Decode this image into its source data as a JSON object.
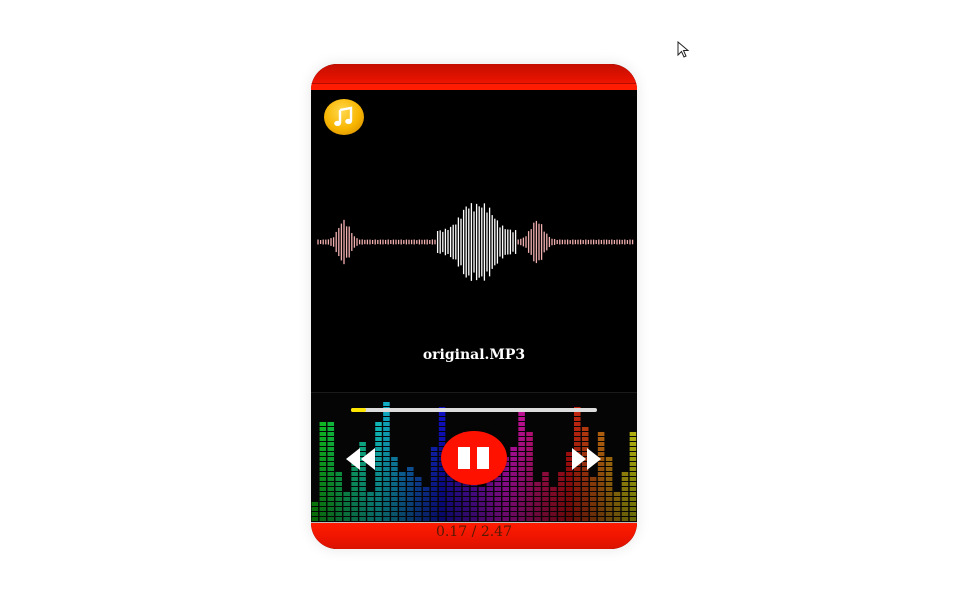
{
  "player": {
    "track_title": "original.MP3",
    "current_time": "0.17",
    "separator": " / ",
    "total_time": "2.47",
    "progress_fraction": 0.06
  },
  "icons": {
    "music_icon": "music-note-icon",
    "rewind": "rewind-icon",
    "pause": "pause-icon",
    "forward": "fast-forward-icon",
    "cursor": "mouse-pointer-icon"
  },
  "colors": {
    "accent_red": "#ff1100",
    "progress_yellow": "#ffe600",
    "icon_gold": "#f8b500"
  }
}
